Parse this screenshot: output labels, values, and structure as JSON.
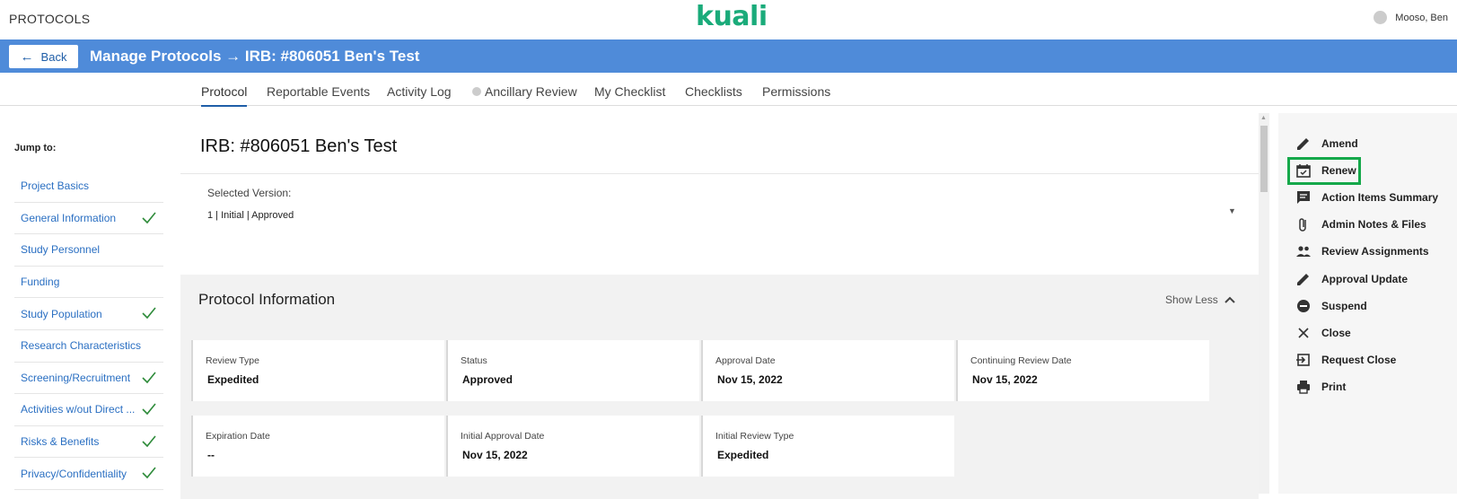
{
  "app": {
    "title": "PROTOCOLS",
    "logo": "kuali",
    "user": "Mooso, Ben"
  },
  "header": {
    "back_label": "Back",
    "title": "Manage Protocols → IRB: #806051 Ben's Test"
  },
  "tabs": [
    {
      "label": "Protocol",
      "active": true
    },
    {
      "label": "Reportable Events"
    },
    {
      "label": "Activity Log"
    },
    {
      "label": "Ancillary Review",
      "status_dot": true
    },
    {
      "label": "My Checklist"
    },
    {
      "label": "Checklists"
    },
    {
      "label": "Permissions"
    }
  ],
  "sidebar": {
    "jump_label": "Jump to:",
    "items": [
      {
        "label": "Project Basics",
        "complete": false
      },
      {
        "label": "General Information",
        "complete": true
      },
      {
        "label": "Study Personnel",
        "complete": false
      },
      {
        "label": "Funding",
        "complete": false
      },
      {
        "label": "Study Population",
        "complete": true
      },
      {
        "label": "Research Characteristics",
        "complete": false
      },
      {
        "label": "Screening/Recruitment",
        "complete": true
      },
      {
        "label": "Activities w/out Direct ...",
        "complete": true
      },
      {
        "label": "Risks & Benefits",
        "complete": true
      },
      {
        "label": "Privacy/Confidentiality",
        "complete": true
      }
    ]
  },
  "main": {
    "title": "IRB: #806051 Ben's Test",
    "version_label": "Selected Version:",
    "version_value": "1 | Initial | Approved",
    "protocol_info": {
      "title": "Protocol Information",
      "toggle_label": "Show Less",
      "cards": [
        {
          "label": "Review Type",
          "value": "Expedited"
        },
        {
          "label": "Status",
          "value": "Approved"
        },
        {
          "label": "Approval Date",
          "value": "Nov 15, 2022"
        },
        {
          "label": "Continuing Review Date",
          "value": "Nov 15, 2022"
        },
        {
          "label": "Expiration Date",
          "value": "--"
        },
        {
          "label": "Initial Approval Date",
          "value": "Nov 15, 2022"
        },
        {
          "label": "Initial Review Type",
          "value": "Expedited"
        }
      ]
    }
  },
  "actions": [
    {
      "label": "Amend",
      "icon": "pencil-icon"
    },
    {
      "label": "Renew",
      "icon": "calendar-check-icon",
      "highlighted": true
    },
    {
      "label": "Action Items Summary",
      "icon": "comment-icon"
    },
    {
      "label": "Admin Notes & Files",
      "icon": "paperclip-icon"
    },
    {
      "label": "Review Assignments",
      "icon": "people-icon"
    },
    {
      "label": "Approval Update",
      "icon": "pencil-icon"
    },
    {
      "label": "Suspend",
      "icon": "minus-circle-icon"
    },
    {
      "label": "Close",
      "icon": "close-icon"
    },
    {
      "label": "Request Close",
      "icon": "exit-icon"
    },
    {
      "label": "Print",
      "icon": "printer-icon"
    }
  ],
  "colors": {
    "header_blue": "#4f8bd9",
    "link_blue": "#2a6fc2",
    "logo_green": "#1aab7a",
    "check_green": "#2e8b3a",
    "highlight_green": "#15a84a"
  }
}
